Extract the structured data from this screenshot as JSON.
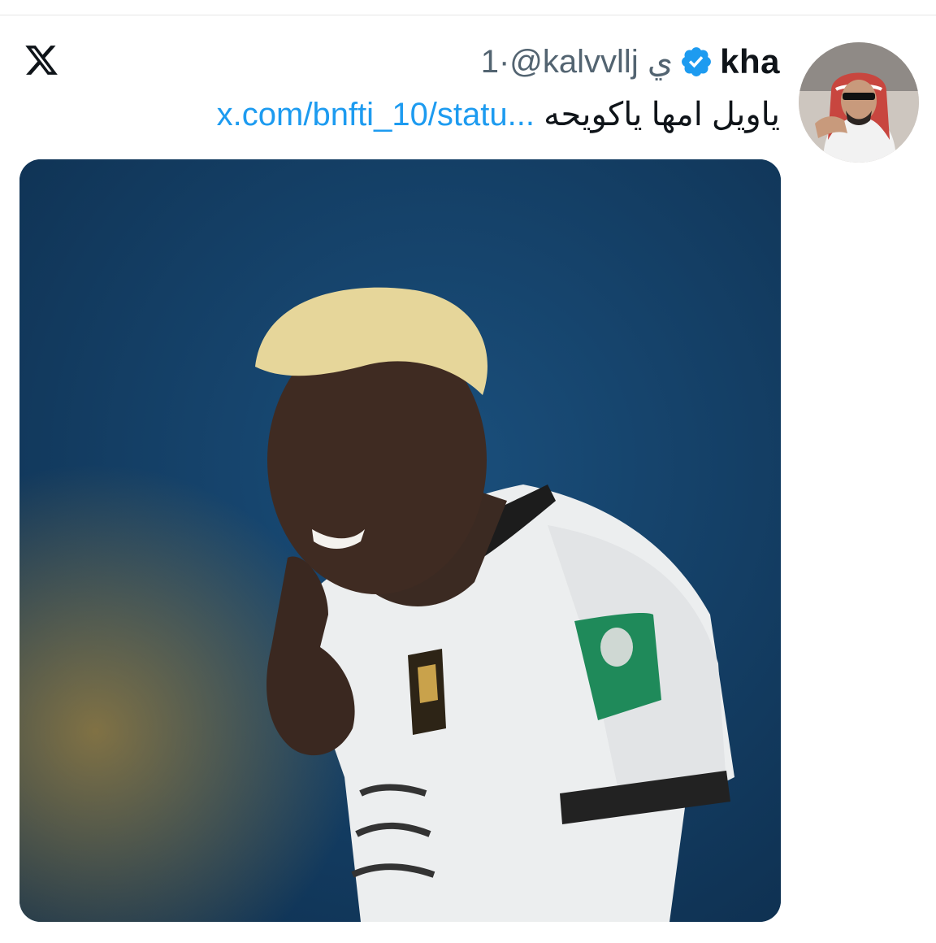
{
  "header": {
    "display_name": "kha",
    "handle_time": "1·@kalvvllj ي"
  },
  "tweet": {
    "text": "ياويل امها ياكويحه",
    "link": "x.com/bnfti_10/statu..."
  },
  "icons": {
    "logo": "x-logo-icon",
    "verified": "verified-badge-icon"
  },
  "colors": {
    "link": "#1d9bf0",
    "verified": "#1d9bf0",
    "text": "#0f1419",
    "muted": "#536471"
  }
}
